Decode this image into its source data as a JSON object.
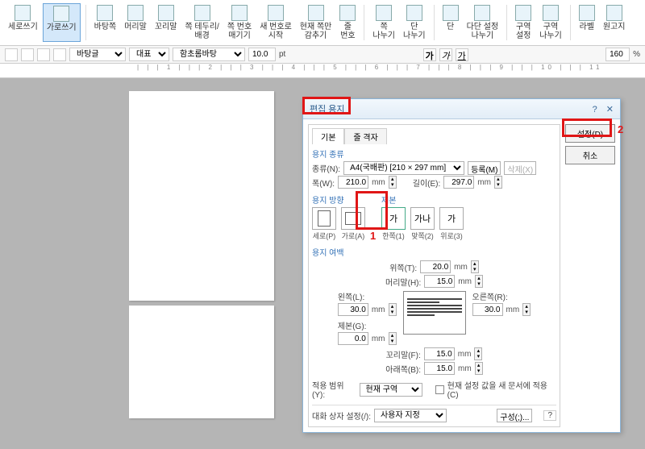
{
  "ribbon": {
    "items": [
      {
        "label": "세로쓰기"
      },
      {
        "label": "가로쓰기"
      },
      {
        "label": "바탕쪽"
      },
      {
        "label": "머리말"
      },
      {
        "label": "꼬리말"
      },
      {
        "label": "쪽 테두리/\n배경"
      },
      {
        "label": "쪽 번호\n매기기"
      },
      {
        "label": "새 번호로\n시작"
      },
      {
        "label": "현재 쪽만\n감추기"
      },
      {
        "label": "줄\n번호"
      },
      {
        "label": "쪽\n나누기"
      },
      {
        "label": "단\n나누기"
      },
      {
        "label": "단"
      },
      {
        "label": "다단 설정\n나누기"
      },
      {
        "label": "구역\n설정"
      },
      {
        "label": "구역\n나누기"
      },
      {
        "label": "라벨"
      },
      {
        "label": "원고지"
      }
    ]
  },
  "toolbar": {
    "style": "바탕글",
    "rep": "대표",
    "font": "함초롬바탕",
    "size": "10.0",
    "sizeUnit": "pt",
    "zoom": "160",
    "zoomUnit": "%"
  },
  "dialog": {
    "title": "편집 용지",
    "help": "?",
    "close": "✕",
    "tabs": {
      "t1": "기본",
      "t2": "줄 격자"
    },
    "btns": {
      "ok": "설정(D)",
      "cancel": "취소"
    },
    "paperKind": {
      "label": "용지 종류",
      "typeLabel": "종류(N):",
      "type": "A4(국배판) [210 × 297 mm]",
      "reg": "등록(M)",
      "del": "삭제(X)",
      "wLabel": "폭(W):",
      "w": "210.0",
      "hLabel": "길이(E):",
      "h": "297.0",
      "unit": "mm"
    },
    "orient": {
      "label": "용지 방향",
      "port": "세로(P)",
      "land": "가로(A)"
    },
    "binding": {
      "label": "제본",
      "one": "한쪽(1)",
      "two": "맞쪽(2)",
      "up": "위로(3)",
      "g1": "가",
      "g2": "가나",
      "g3": "가"
    },
    "margins": {
      "label": "용지 여백",
      "top": "위쪽(T):",
      "topV": "20.0",
      "header": "머리말(H):",
      "headerV": "15.0",
      "left": "왼쪽(L):",
      "leftV": "30.0",
      "right": "오른쪽(R):",
      "rightV": "30.0",
      "gutter": "제본(G):",
      "gutterV": "0.0",
      "footer": "꼬리말(F):",
      "footerV": "15.0",
      "bottom": "아래쪽(B):",
      "bottomV": "15.0",
      "unit": "mm"
    },
    "scope": {
      "label": "적용 범위(Y):",
      "value": "현재 구역",
      "chkLabel": "현재 설정 값을 새 문서에 적용(C)"
    },
    "preset": {
      "label": "대화 상자 설정(/):",
      "value": "사용자 지정",
      "compose": "구성(;)..."
    }
  },
  "annot": {
    "n1": "1",
    "n2": "2"
  }
}
